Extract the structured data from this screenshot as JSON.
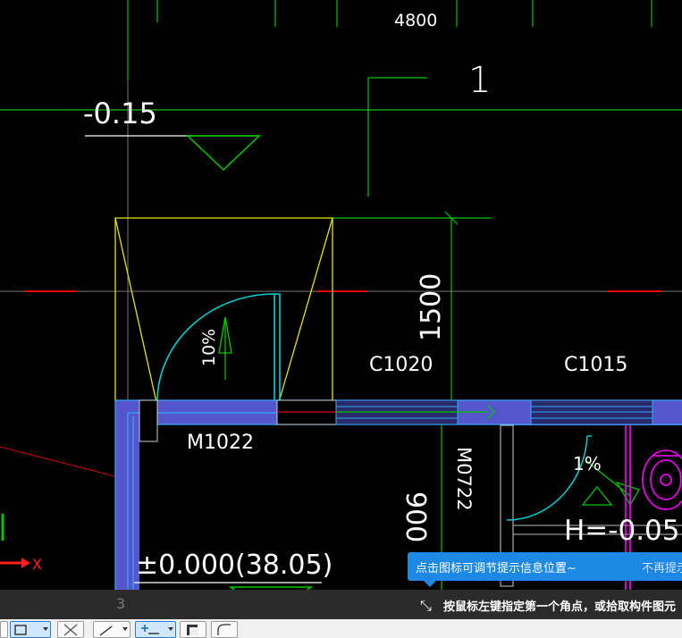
{
  "drawing": {
    "labels": {
      "top_dimension": "4800",
      "axis_number": "1",
      "elevation_top": "-0.15",
      "dim_vertical": "1500",
      "slope_left": "10%",
      "window_c1020": "C1020",
      "window_c1015": "C1015",
      "door_m1022": "M1022",
      "door_m0722": "M0722",
      "slope_right": "1%",
      "elevation_h": "H=-0.05",
      "dim_900": "900",
      "elevation_zero": "±0.000(38.05)",
      "ucs_x": "X",
      "ghost_3": "3"
    },
    "colors": {
      "background": "#000000",
      "axis": "#00c800",
      "annotation": "#ffffff",
      "wall_fill": "#5555cc",
      "wall_edge": "#33aaff",
      "door_arc": "#00d0d0",
      "yellow_lines": "#e6e600",
      "magenta_fixtures": "#ff00ff",
      "red_centerline": "#ff0000"
    }
  },
  "tooltip": {
    "message": "点击图标可调节提示信息位置~",
    "dismiss_label": "不再提示"
  },
  "command_bar": {
    "prompt": "按鼠标左键指定第一个角点，或拾取构件图元",
    "prompt_icon": "crosshair-pick-icon"
  },
  "toolbar": {
    "buttons": [
      {
        "icon": "select-icon"
      },
      {
        "icon": "rectangle-select-icon"
      },
      {
        "icon": "delete-icon"
      },
      {
        "icon": "draw-line-icon"
      },
      {
        "icon": "point-add-icon"
      },
      {
        "icon": "copy-icon"
      },
      {
        "icon": "arc-icon"
      }
    ]
  }
}
